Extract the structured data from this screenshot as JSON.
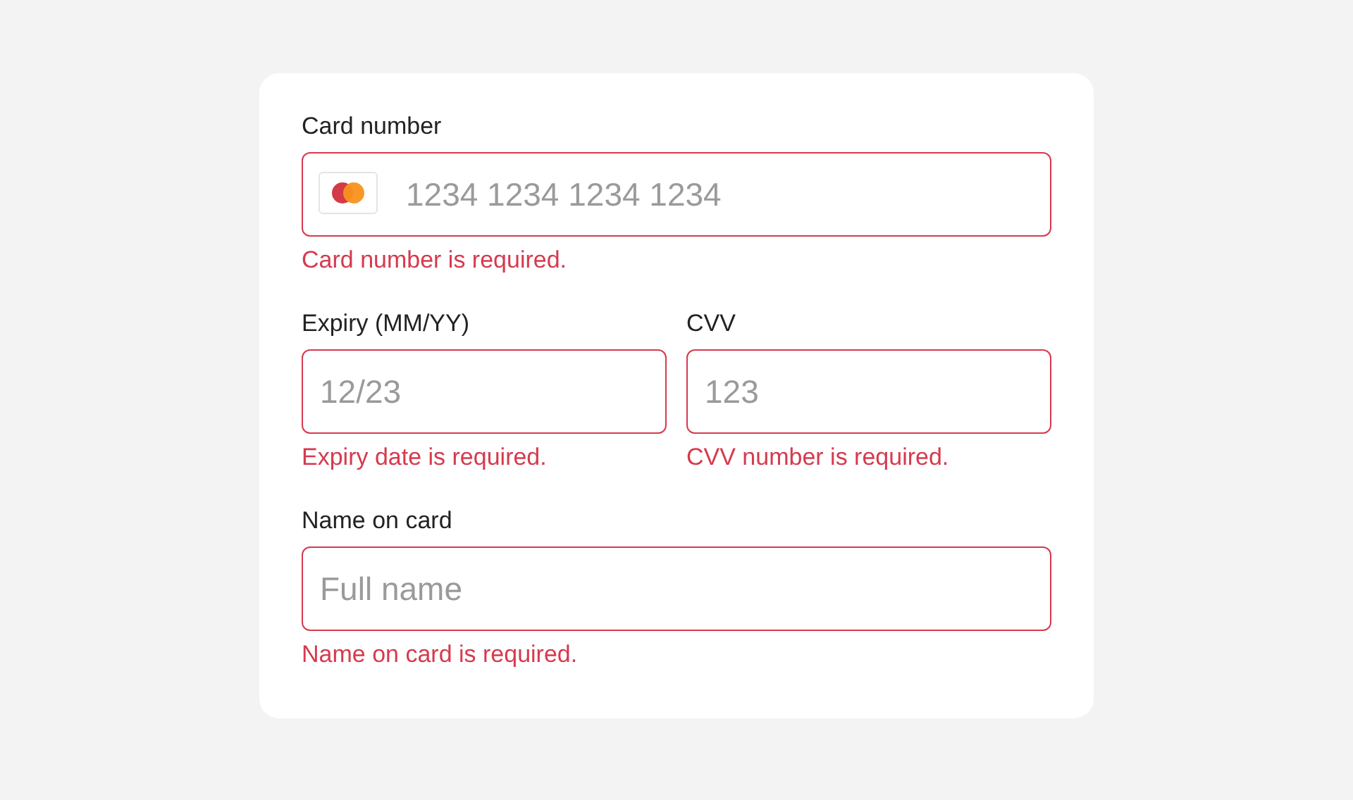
{
  "fields": [
    {
      "kind": "card",
      "label": "Card number",
      "placeholder": "1234 1234 1234 1234",
      "invalid": true,
      "error": "Card number is required."
    },
    {
      "kind": "half",
      "label": "Expiry (MM/YY)",
      "placeholder": "12/23",
      "invalid": true,
      "error": "Expiry date is required."
    },
    {
      "kind": "half",
      "label": "CVV",
      "placeholder": "123",
      "invalid": true,
      "error": "CVV number is required."
    },
    {
      "kind": "full",
      "label": "Name on card",
      "placeholder": "Full name",
      "invalid": true,
      "error": "Name on card is required."
    }
  ]
}
